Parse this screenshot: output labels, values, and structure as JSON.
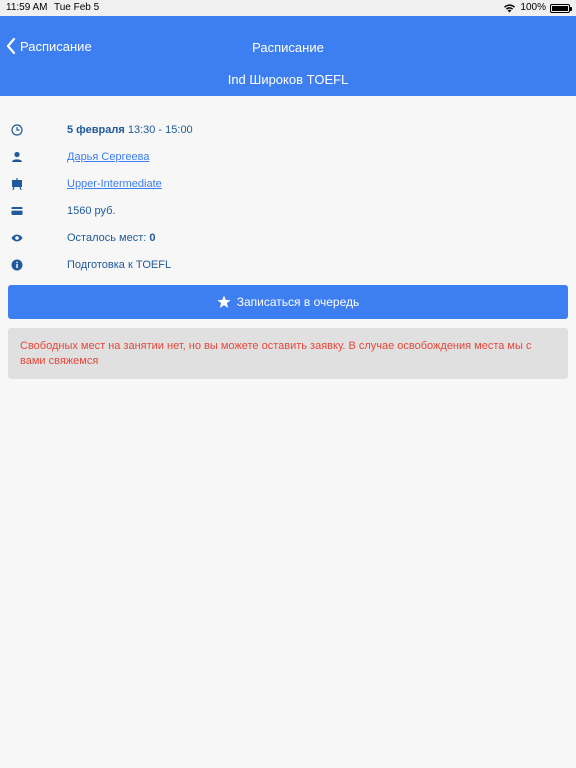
{
  "status": {
    "time": "11:59 AM",
    "date": "Tue Feb 5",
    "battery": "100%",
    "battery_level": 1.0
  },
  "header": {
    "back_label": "Расписание",
    "title": "Расписание",
    "subtitle": "Ind Широков TOEFL"
  },
  "details": {
    "date_bold": "5 февраля",
    "time": "13:30 - 15:00",
    "teacher": "Дарья Сергеева",
    "level": "Upper-Intermediate",
    "price": "1560 руб.",
    "seats_label": "Осталось мест:",
    "seats_value": "0",
    "description": "Подготовка к TOEFL"
  },
  "button": {
    "label": "Записаться в очередь"
  },
  "alert": {
    "text": "Свободных мест на занятии нет, но вы можете оставить заявку. В случае освобождения места мы с вами свяжемся"
  },
  "colors": {
    "accent": "#3d7ef0",
    "icon": "#1f5a9a",
    "alert_text": "#e5483b",
    "alert_bg": "#e0e0e0"
  },
  "icons": [
    "clock-icon",
    "person-icon",
    "level-icon",
    "credit-card-icon",
    "eye-icon",
    "info-icon",
    "star-icon",
    "chevron-left-icon",
    "wifi-icon",
    "battery-icon"
  ]
}
